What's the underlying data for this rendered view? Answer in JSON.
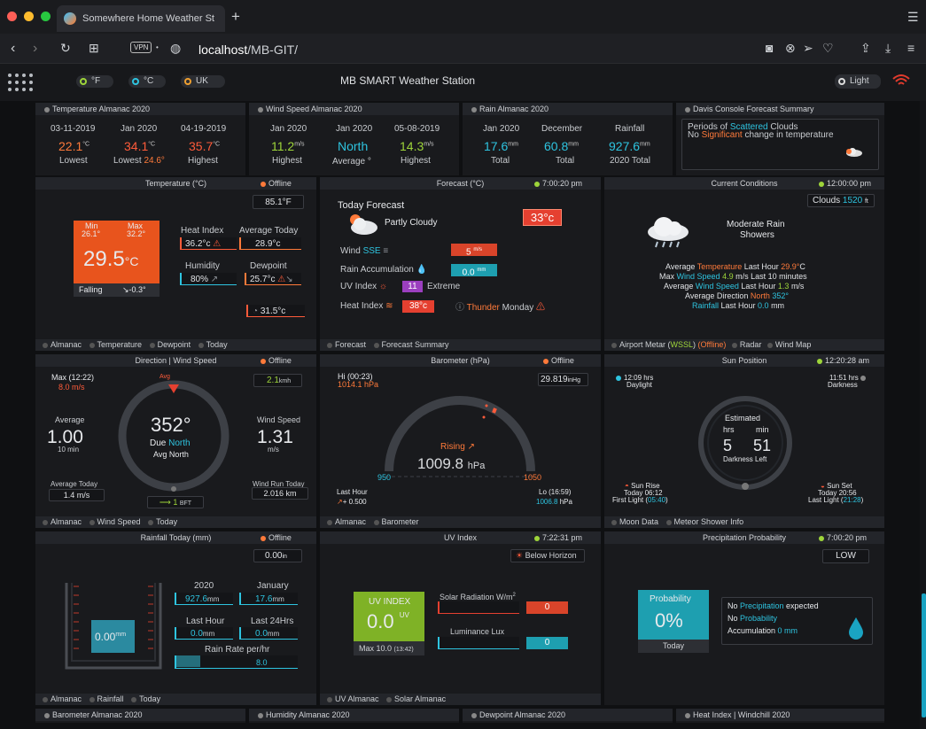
{
  "browser": {
    "tab_title": "Somewhere Home Weather St",
    "url_host": "localhost",
    "url_path": "/MB-GIT/",
    "vpn": "VPN"
  },
  "app": {
    "title": "MB SMART Weather Station",
    "units": [
      "°F",
      "°C",
      "UK"
    ],
    "theme": "Light"
  },
  "almanac": {
    "temp": {
      "title": "Temperature Almanac 2020",
      "cols": [
        {
          "date": "03-11-2019",
          "val": "22.1",
          "unit": "°C",
          "label": "Lowest"
        },
        {
          "date": "Jan 2020",
          "val": "34.1",
          "unit": "°C",
          "label": "Lowest",
          "extra": "24.6°"
        },
        {
          "date": "04-19-2019",
          "val": "35.7",
          "unit": "°C",
          "label": "Highest"
        }
      ]
    },
    "wind": {
      "title": "Wind Speed Almanac 2020",
      "cols": [
        {
          "date": "Jan 2020",
          "val": "11.2",
          "unit": "m/s",
          "label": "Highest"
        },
        {
          "date": "Jan 2020",
          "val": "North",
          "unit": "",
          "label": "Average °"
        },
        {
          "date": "05-08-2019",
          "val": "14.3",
          "unit": "m/s",
          "label": "Highest"
        }
      ]
    },
    "rain": {
      "title": "Rain Almanac 2020",
      "cols": [
        {
          "date": "Jan 2020",
          "val": "17.6",
          "unit": "mm",
          "label": "Total"
        },
        {
          "date": "December",
          "val": "60.8",
          "unit": "mm",
          "label": "Total"
        },
        {
          "date": "Rainfall",
          "val": "927.6",
          "unit": "mm",
          "label": "2020 Total"
        }
      ]
    },
    "davis": {
      "title": "Davis Console Forecast Summary",
      "l1a": "Periods of ",
      "l1b": "Scattered",
      "l1c": " Clouds",
      "l2a": "No ",
      "l2b": "Significant",
      "l2c": " change in temperature"
    }
  },
  "temperature": {
    "title": "Temperature (°C)",
    "status": "Offline",
    "feels": "85.1°F",
    "min_l": "Min",
    "min": "26.1°",
    "max_l": "Max",
    "max": "32.2°",
    "current": "29.5",
    "unit": "°C",
    "trend": "Falling",
    "trend_val": "↘-0.3°",
    "hi_l": "Heat Index",
    "hi": "36.2°c",
    "avg_l": "Average Today",
    "avg": "28.9°c",
    "hum_l": "Humidity",
    "hum": "80%",
    "dew_l": "Dewpoint",
    "dew": "25.7°c",
    "indoor": "31.5°c",
    "footer": [
      "Almanac",
      "Temperature",
      "Dewpoint",
      "Today"
    ]
  },
  "forecast": {
    "title": "Forecast (°C)",
    "time": "7:00:20 pm",
    "heading": "Today Forecast",
    "cond": "Partly Cloudy",
    "temp": "33°c",
    "wind_l": "Wind",
    "wind_dir": "SSE",
    "wind": "5",
    "wind_u": "m/s",
    "rain_l": "Rain Accumulation",
    "rain": "0.0",
    "rain_u": "mm",
    "uv_l": "UV Index",
    "uv": "11",
    "uv_t": "Extreme",
    "hi_l": "Heat Index",
    "hi": "38°c",
    "thunder": "Thunder",
    "day": "Monday",
    "footer": [
      "Forecast",
      "Forecast Summary"
    ]
  },
  "current": {
    "title": "Current Conditions",
    "time": "12:00:00 pm",
    "clouds_l": "Clouds",
    "clouds": "1520",
    "clouds_u": "ft",
    "cond1": "Moderate Rain",
    "cond2": "Showers",
    "l1": [
      "Average ",
      "Temperature",
      " Last Hour ",
      "29.9°",
      "C"
    ],
    "l2": [
      "Max ",
      "Wind Speed",
      " ",
      "4.9",
      " m/s Last 10 minutes"
    ],
    "l3": [
      "Average ",
      "Wind Speed",
      " Last Hour ",
      "1.3",
      " m/s"
    ],
    "l4": [
      "Average Direction ",
      "North",
      " ",
      "352°"
    ],
    "l5": [
      "Rainfall",
      " Last Hour ",
      "0.0",
      " mm"
    ],
    "footer": [
      "Airport Metar (",
      "WSSL",
      ") ",
      "(Offline)",
      "Radar",
      "Wind Map"
    ]
  },
  "direction": {
    "title": "Direction | Wind Speed",
    "status": "Offline",
    "max_l": "Max (12:22)",
    "max": "8.0 m/s",
    "gust": "2.1",
    "gust_u": "kmh",
    "avg_l": "Average",
    "avg": "1.00",
    "avg_s": "10 min",
    "deg": "352°",
    "due": "Due ",
    "due_dir": "North",
    "avg_dir": "Avg North",
    "avg_tag": "Avg",
    "ws_l": "Wind Speed",
    "ws": "1.31",
    "ws_u": "m/s",
    "avgtoday_l": "Average Today",
    "avgtoday": "1.4 m/s",
    "bft": "1",
    "bft_u": "BFT",
    "run_l": "Wind Run Today",
    "run": "2.016 km",
    "footer": [
      "Almanac",
      "Wind Speed",
      "Today"
    ]
  },
  "barometer": {
    "title": "Barometer (hPa)",
    "status": "Offline",
    "hi_l": "Hi (00:23)",
    "hi": "1014.1 hPa",
    "val_inhg": "29.819",
    "inhg": "inHg",
    "trend": "Rising",
    "value": "1009.8",
    "unit": "hPa",
    "min": "950",
    "max": "1050",
    "lh_l": "Last Hour",
    "lh": "+ 0.500",
    "lo_l": "Lo (16:59)",
    "lo": "1006.8",
    "lo_u": "hPa",
    "footer": [
      "Almanac",
      "Barometer"
    ]
  },
  "sun": {
    "title": "Sun Position",
    "time": "12:20:28 am",
    "day_h": "12:09 hrs",
    "day_l": "Daylight",
    "dark_h": "11:51 hrs",
    "dark_l": "Darkness",
    "est": "Estimated",
    "hrs_l": "hrs",
    "min_l": "min",
    "hrs": "5",
    "min": "51",
    "dl": "Darkness Left",
    "rise_l": "Sun Rise",
    "rise": "Today 06:12",
    "first": "First Light (",
    "first_t": "05:40",
    "set_l": "Sun Set",
    "set": "Today 20:56",
    "last": "Last Light (",
    "last_t": "21:28",
    "footer": [
      "Moon Data",
      "Meteor Shower Info"
    ]
  },
  "rainfall": {
    "title": "Rainfall Today (mm)",
    "status": "Offline",
    "rate_in": "0.00",
    "rate_in_u": "in",
    "today": "0.00",
    "today_u": "mm",
    "y_l": "2020",
    "y": "927.6",
    "m_l": "January",
    "m": "17.6",
    "lh_l": "Last Hour",
    "lh": "0.0",
    "l24_l": "Last 24Hrs",
    "l24": "0.0",
    "u": "mm",
    "rate_l": "Rain Rate per/hr",
    "rate": "8.0",
    "footer": [
      "Almanac",
      "Rainfall",
      "Today"
    ]
  },
  "uv": {
    "title": "UV Index",
    "time": "7:22:31 pm",
    "below": "Below Horizon",
    "uv_l": "UV INDEX",
    "uv": "0.0",
    "uv_u": "UV",
    "max": "Max 10.0",
    "max_t": "(13:42)",
    "solar_l": "Solar Radiation W/m",
    "solar_sup": "2",
    "solar": "0",
    "lux_l": "Luminance Lux",
    "lux": "0",
    "footer": [
      "UV Almanac",
      "Solar Almanac"
    ]
  },
  "precip": {
    "title": "Precipitation Probability",
    "time": "7:00:20 pm",
    "level": "LOW",
    "prob_l": "Probability",
    "prob": "0%",
    "today": "Today",
    "l1a": "No ",
    "l1b": "Precipitation",
    "l1c": " expected",
    "l2a": "No ",
    "l2b": "Probability",
    "l3": "Accumulation ",
    "l3v": "0 mm"
  },
  "bottom": [
    "Barometer Almanac 2020",
    "Humidity Almanac 2020",
    "Dewpoint Almanac 2020",
    "Heat Index | Windchill 2020"
  ],
  "colors": {
    "accent_orange": "#ff7a3a",
    "accent_blue": "#2ec4e0",
    "accent_green": "#9ed53a",
    "temp_box": "#e8541d",
    "uv_box": "#7fb226",
    "prob_box": "#1e9fb0"
  }
}
